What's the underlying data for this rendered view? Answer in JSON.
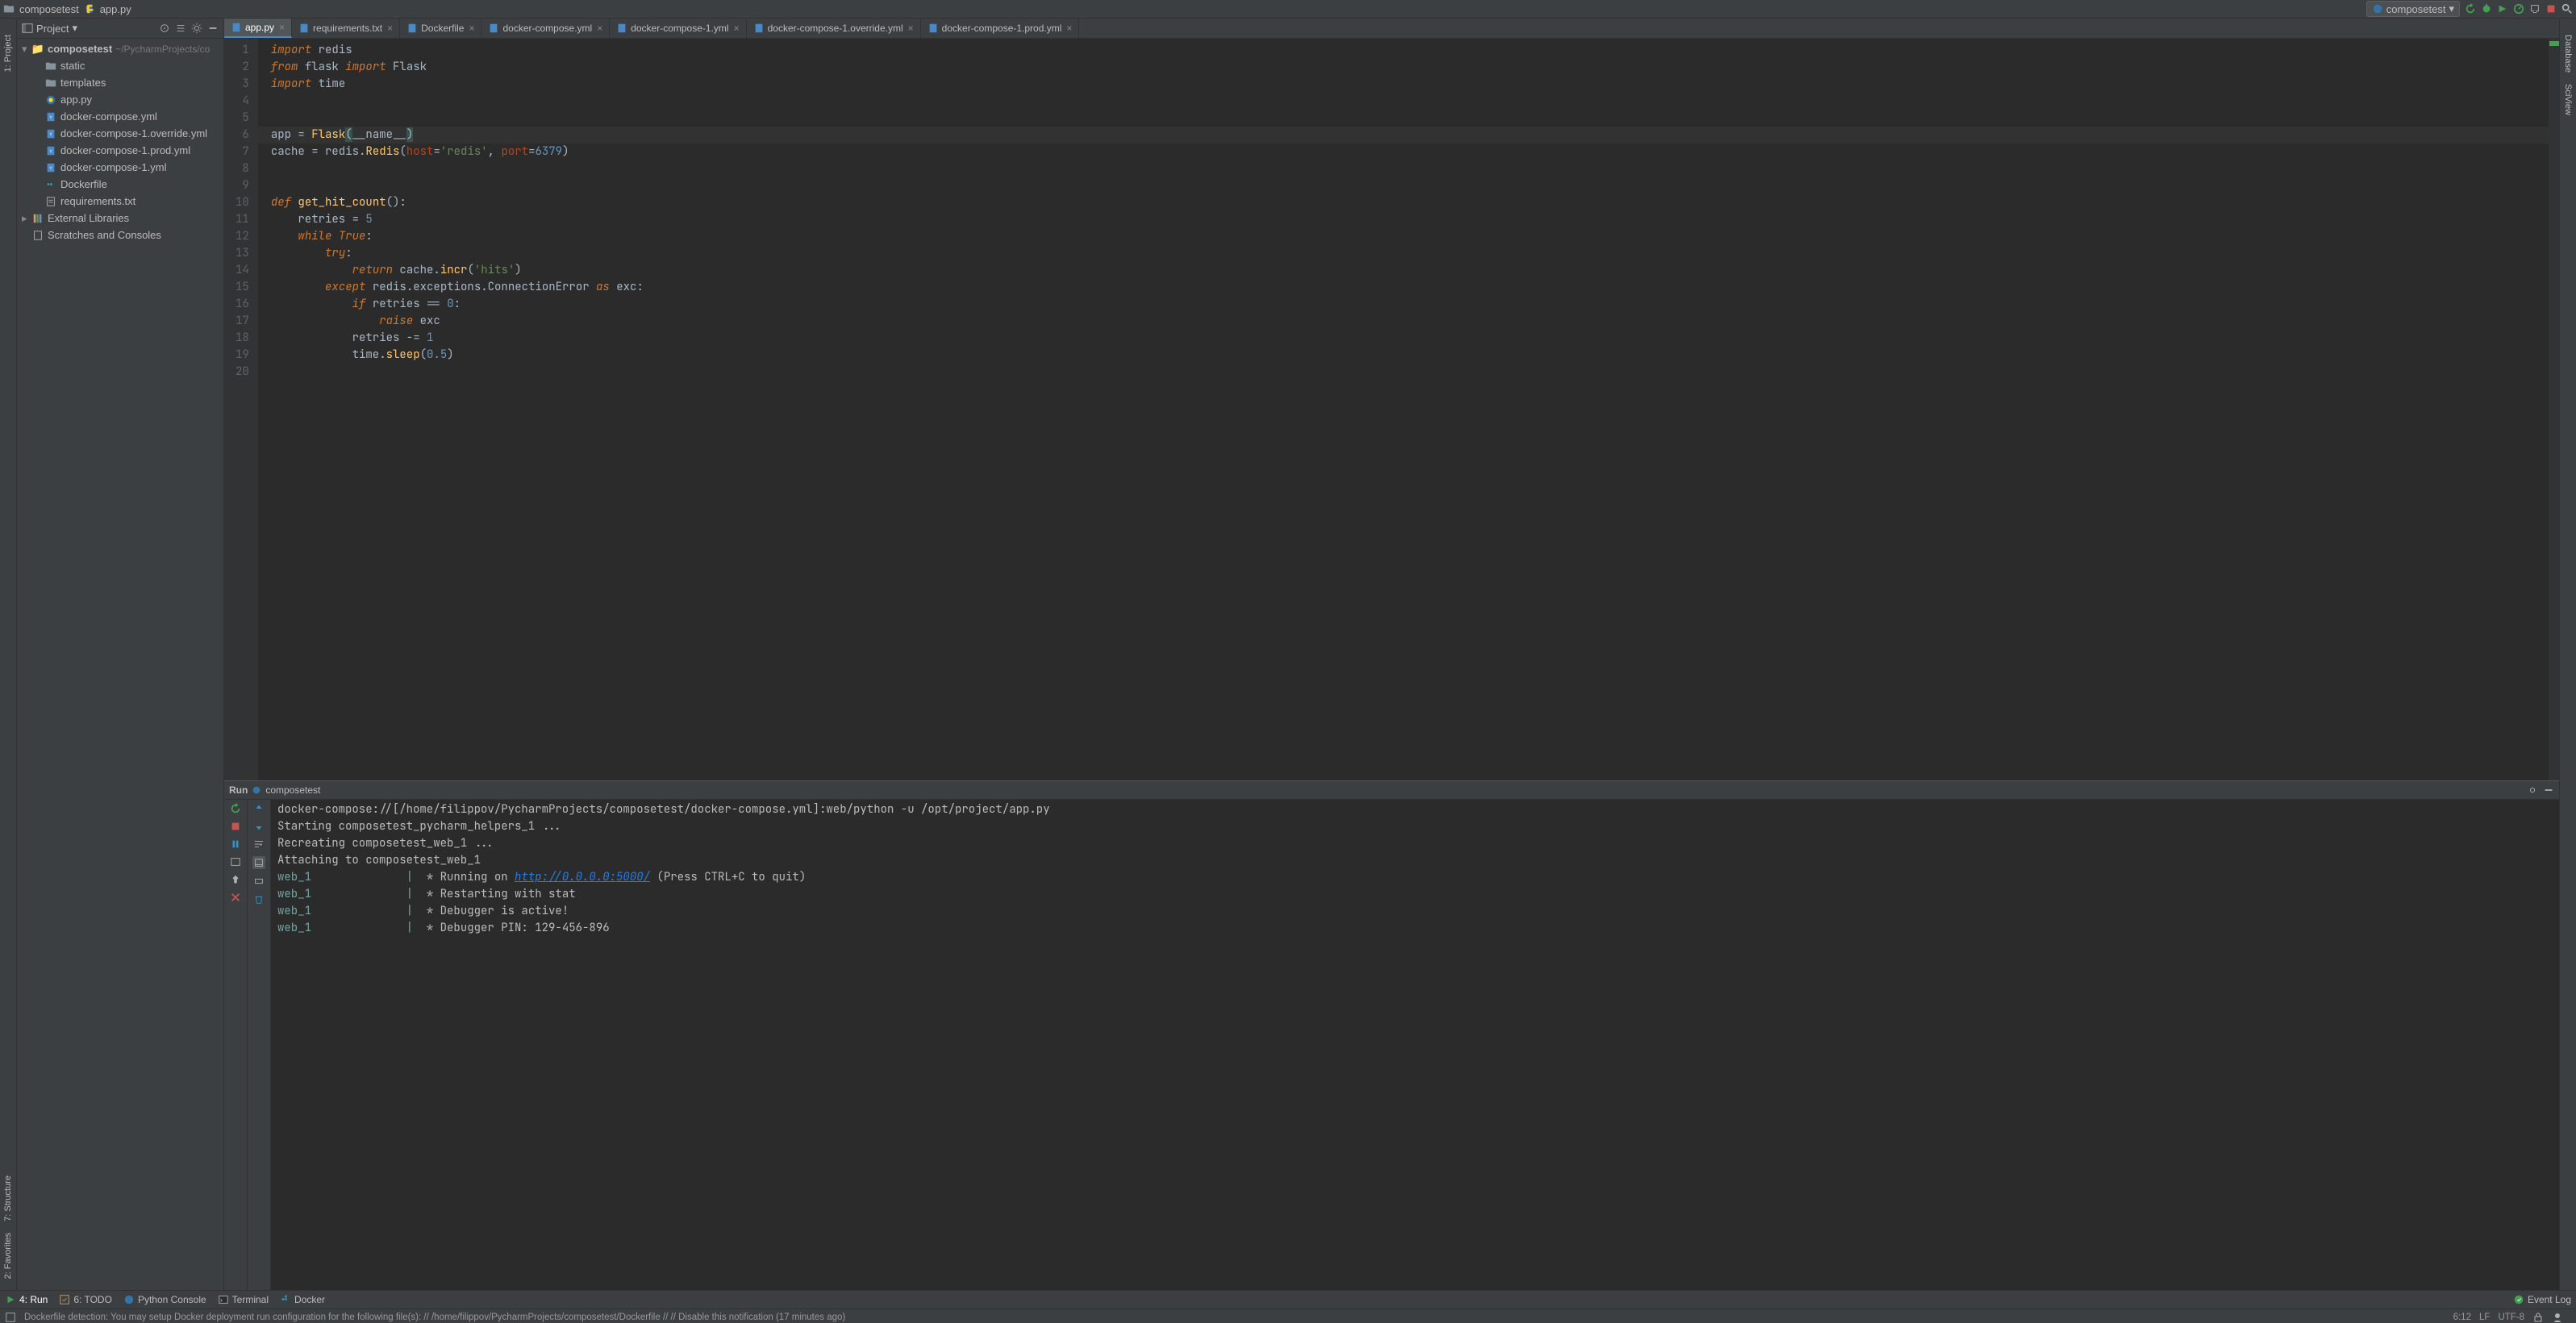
{
  "topbar": {
    "folder": "composetest",
    "file": "app.py",
    "run_config": "composetest"
  },
  "project_panel": {
    "title": "Project",
    "root": {
      "name": "composetest",
      "path": "~/PycharmProjects/co"
    },
    "children": [
      {
        "name": "static",
        "type": "folder"
      },
      {
        "name": "templates",
        "type": "folder"
      },
      {
        "name": "app.py",
        "type": "py"
      },
      {
        "name": "docker-compose.yml",
        "type": "yml"
      },
      {
        "name": "docker-compose-1.override.yml",
        "type": "yml"
      },
      {
        "name": "docker-compose-1.prod.yml",
        "type": "yml"
      },
      {
        "name": "docker-compose-1.yml",
        "type": "yml"
      },
      {
        "name": "Dockerfile",
        "type": "docker"
      },
      {
        "name": "requirements.txt",
        "type": "txt"
      }
    ],
    "extra": [
      {
        "name": "External Libraries"
      },
      {
        "name": "Scratches and Consoles"
      }
    ]
  },
  "tabs": [
    {
      "label": "app.py",
      "active": true
    },
    {
      "label": "requirements.txt",
      "active": false
    },
    {
      "label": "Dockerfile",
      "active": false
    },
    {
      "label": "docker-compose.yml",
      "active": false
    },
    {
      "label": "docker-compose-1.yml",
      "active": false
    },
    {
      "label": "docker-compose-1.override.yml",
      "active": false
    },
    {
      "label": "docker-compose-1.prod.yml",
      "active": false
    }
  ],
  "code_lines": 20,
  "code": {
    "l1": {
      "a": "import",
      "b": " redis"
    },
    "l2": {
      "a": "from",
      "b": " flask ",
      "c": "import",
      "d": " Flask"
    },
    "l3": {
      "a": "import",
      "b": " time"
    },
    "l6": {
      "a": "app = ",
      "b": "Flask",
      "c": "(",
      "d": "__name__",
      "e": ")"
    },
    "l7": {
      "a": "cache = redis.",
      "b": "Redis",
      "c": "(",
      "d": "host",
      "e": "=",
      "f": "'redis'",
      "g": ", ",
      "h": "port",
      "i": "=",
      "j": "6379",
      "k": ")"
    },
    "l10": {
      "a": "def ",
      "b": "get_hit_count",
      "c": "():"
    },
    "l11": {
      "a": "    retries = ",
      "b": "5"
    },
    "l12": {
      "a": "    ",
      "b": "while True",
      "c": ":"
    },
    "l13": {
      "a": "        ",
      "b": "try",
      "c": ":"
    },
    "l14": {
      "a": "            ",
      "b": "return",
      "c": " cache.",
      "d": "incr",
      "e": "(",
      "f": "'hits'",
      "g": ")"
    },
    "l15": {
      "a": "        ",
      "b": "except",
      "c": " redis.exceptions.ConnectionError ",
      "d": "as",
      "e": " exc",
      "f": ":"
    },
    "l16": {
      "a": "            ",
      "b": "if",
      "c": " retries == ",
      "d": "0",
      "e": ":"
    },
    "l17": {
      "a": "                ",
      "b": "raise",
      "c": " exc"
    },
    "l18": {
      "a": "            retries -= ",
      "b": "1"
    },
    "l19": {
      "a": "            time.",
      "b": "sleep",
      "c": "(",
      "d": "0.5",
      "e": ")"
    }
  },
  "run_panel": {
    "title": "Run",
    "config": "composetest"
  },
  "console": {
    "l1": "docker-compose://[/home/filippov/PycharmProjects/composetest/docker-compose.yml]:web/python -u /opt/project/app.py",
    "l2": "Starting composetest_pycharm_helpers_1 ...",
    "l3": "Recreating composetest_web_1 ...",
    "l4": "Attaching to composetest_web_1",
    "l5_web": "web_1",
    "l5_bar": "|",
    "l5_txt1": "  * Running on ",
    "l5_url": "http://0.0.0.0:5000/",
    "l5_txt2": " (Press CTRL+C to quit)",
    "l6_txt": "  * Restarting with stat",
    "l7_txt": "  * Debugger is active!",
    "l8_txt": "  * Debugger PIN: 129-456-896"
  },
  "bottom_toolbar": {
    "run": "4: Run",
    "todo": "6: TODO",
    "python_console": "Python Console",
    "terminal": "Terminal",
    "docker": "Docker",
    "event_log": "Event Log"
  },
  "status_bar": {
    "msg": "Dockerfile detection: You may setup Docker deployment run configuration for the following file(s): // /home/filippov/PycharmProjects/composetest/Dockerfile // // Disable this notification (17 minutes ago)",
    "pos": "6:12",
    "lf": "LF",
    "enc": "UTF-8"
  },
  "side_labels": {
    "project": "1: Project",
    "structure": "7: Structure",
    "favorites": "2: Favorites",
    "database": "Database",
    "sciview": "SciView"
  }
}
